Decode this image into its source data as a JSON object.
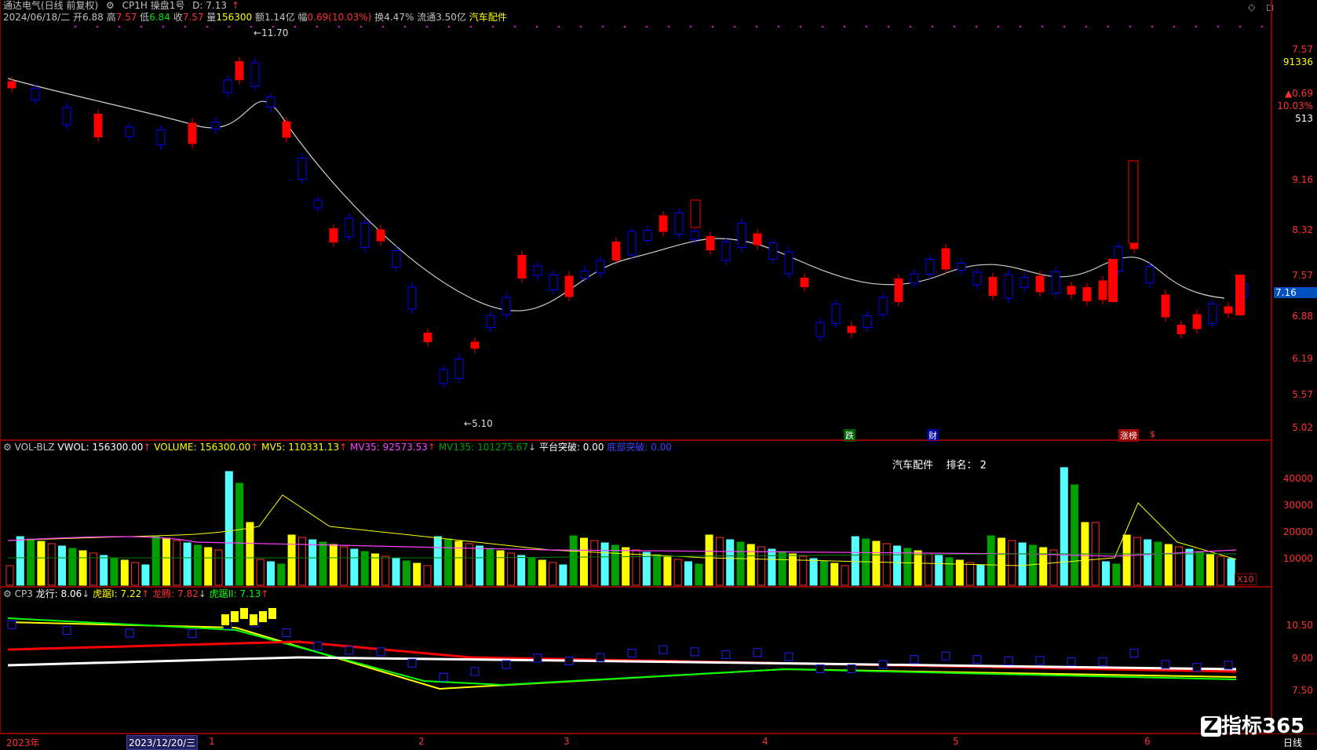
{
  "header": {
    "stock_name": "通达电气(日线 前复权)",
    "formula": "CP1H 操盘1号",
    "d_value": "D: 7.13",
    "d_arrow": "↑",
    "date": "2024/06/18/二",
    "open_label": "开",
    "open": "6.88",
    "high_label": "高",
    "high": "7.57",
    "low_label": "低",
    "low": "6.84",
    "close_label": "收",
    "close": "7.57",
    "vol_label": "量",
    "vol": "156300",
    "amt_label": "额",
    "amt": "1.14亿",
    "chg_label": "幅",
    "chg": "0.69(10.03%)",
    "turn_label": "换",
    "turn": "4.47%",
    "float_label": "流通",
    "float": "3.50亿",
    "sector": "汽车配件"
  },
  "side_panel": {
    "price": "7.57",
    "vol": "91336",
    "chg": "▲0.69",
    "pct": "10.03%",
    "num": "513"
  },
  "price_axis": [
    "9.16",
    "8.32",
    "7.57",
    "6.88",
    "6.19",
    "5.57",
    "5.02"
  ],
  "price_tag": "7.16",
  "annotations": {
    "high": "11.70",
    "low": "5.10",
    "tag1": "跌",
    "tag2": "财",
    "tag3": "涨榜",
    "tag4": "$"
  },
  "vol_header": {
    "name": "VOL-BLZ",
    "vwol": "VWOL: 156300.00",
    "volume": "VOLUME: 156300.00",
    "mv5": "MV5: 110331.13",
    "mv35": "MV35: 92573.53",
    "mv135": "MV135: 101275.67",
    "flat": "平台突破: 0.00",
    "extra": "底部突破: 0.00"
  },
  "vol_note": {
    "sector": "汽车配件",
    "rank": "排名： 2"
  },
  "vol_axis": [
    "40000",
    "30000",
    "20000",
    "10000"
  ],
  "vol_unit": "X10",
  "cp3_header": {
    "name": "CP3",
    "longxing": "龙行: 8.06",
    "hujuI": "虎踞I: 7.22",
    "longteng": "龙腾: 7.82",
    "hujuII": "虎踞II: 7.13"
  },
  "cp3_axis": [
    "10.50",
    "9.00",
    "7.50"
  ],
  "time_axis": {
    "year": "2023年",
    "cursor": "2023/12/20/三",
    "months": [
      "1",
      "2",
      "3",
      "4",
      "5",
      "6"
    ],
    "period": "日线"
  },
  "logo": "指标365",
  "colors": {
    "up": "#ff0000",
    "down": "#0000ff",
    "cyan": "#55ffff",
    "yellow": "#ffff00"
  }
}
